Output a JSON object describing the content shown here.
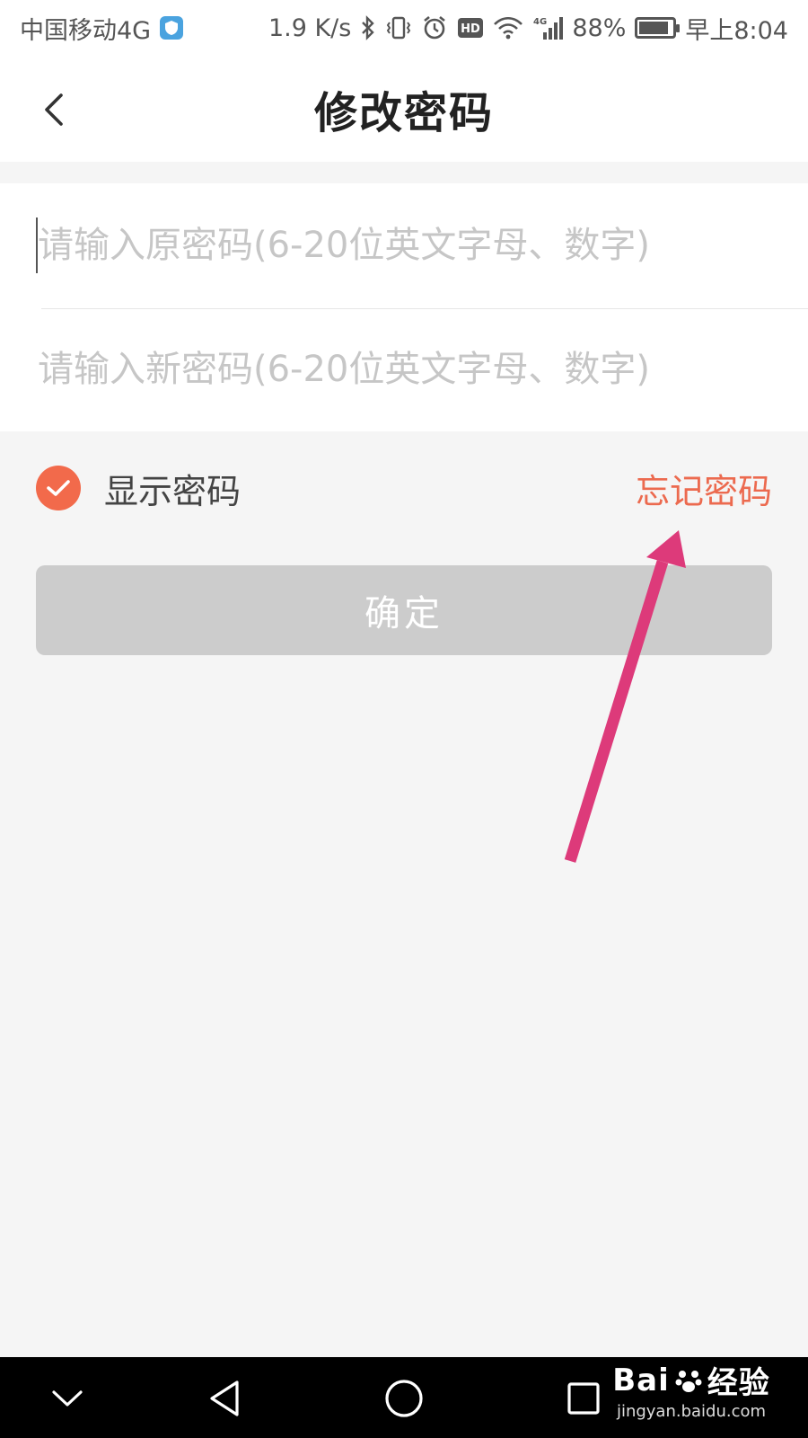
{
  "status_bar": {
    "carrier": "中国移动4G",
    "net_speed": "1.9 K/s",
    "hd_label": "HD",
    "network_type": "4G",
    "battery_level": 0.88,
    "battery_percent": "88%",
    "time": "早上8:04",
    "icons": [
      "shield-icon",
      "bluetooth-icon",
      "vibrate-icon",
      "alarm-icon",
      "hd-icon",
      "wifi-icon",
      "signal-icon",
      "battery-icon"
    ]
  },
  "header": {
    "title": "修改密码",
    "back_icon": "chevron-left-icon"
  },
  "form": {
    "old_password": {
      "value": "",
      "placeholder": "请输入原密码(6-20位英文字母、数字)"
    },
    "new_password": {
      "value": "",
      "placeholder": "请输入新密码(6-20位英文字母、数字)"
    }
  },
  "options": {
    "show_password_label": "显示密码",
    "show_password_checked": true,
    "forgot_password_label": "忘记密码"
  },
  "confirm_button": {
    "label": "确定"
  },
  "nav_bar": {
    "icons": [
      "chevron-down-icon",
      "back-triangle-icon",
      "home-circle-icon",
      "recents-square-icon"
    ]
  },
  "watermark": {
    "logo_text": "Bai",
    "logo_suffix": "经验",
    "url": "jingyan.baidu.com"
  },
  "colors": {
    "accent": "#f26a4b",
    "link": "#ec6a4f",
    "button_disabled": "#cccccc",
    "annotation_arrow": "#dd3a7a",
    "background": "#f5f5f5"
  }
}
